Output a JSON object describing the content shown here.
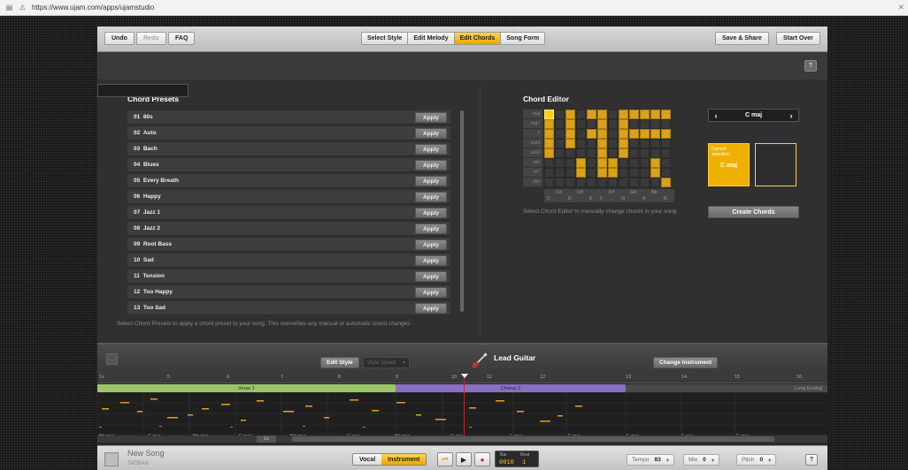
{
  "browser": {
    "url": "https://www.ujam.com/apps/ujamstudio"
  },
  "toolbar": {
    "undo": "Undo",
    "redo": "Redo",
    "faq": "FAQ",
    "tabs": [
      {
        "label": "Select Style",
        "active": false
      },
      {
        "label": "Edit Melody",
        "active": false
      },
      {
        "label": "Edit Chords",
        "active": true
      },
      {
        "label": "Song Form",
        "active": false
      }
    ],
    "save_share": "Save & Share",
    "start_over": "Start Over"
  },
  "help_label": "?",
  "chord_presets": {
    "title": "Chord Presets",
    "apply_label": "Apply",
    "items": [
      {
        "num": "01",
        "name": "80s"
      },
      {
        "num": "02",
        "name": "Auto"
      },
      {
        "num": "03",
        "name": "Bach"
      },
      {
        "num": "04",
        "name": "Blues"
      },
      {
        "num": "05",
        "name": "Every Breath"
      },
      {
        "num": "06",
        "name": "Happy"
      },
      {
        "num": "07",
        "name": "Jazz 1"
      },
      {
        "num": "08",
        "name": "Jazz 2"
      },
      {
        "num": "09",
        "name": "Root Bass"
      },
      {
        "num": "10",
        "name": "Sad"
      },
      {
        "num": "11",
        "name": "Tension"
      },
      {
        "num": "12",
        "name": "Too Happy"
      },
      {
        "num": "13",
        "name": "Too Sad"
      }
    ],
    "hint": "Select Chord Presets to apply a chord preset to your song. This overwrites any manual or automatic chord changes"
  },
  "chord_editor": {
    "title": "Chord Editor",
    "row_labels": [
      "maj",
      "maj7",
      "7",
      "sus4",
      "sus2",
      "min",
      "m7",
      "dim"
    ],
    "sharp_notes": [
      "C#",
      "D#",
      "F#",
      "G#",
      "Bb"
    ],
    "natural_notes": [
      "C",
      "D",
      "E",
      "F",
      "G",
      "A",
      "B"
    ],
    "grid": [
      [
        2,
        0,
        1,
        0,
        1,
        1,
        0,
        1,
        1,
        1,
        1,
        1
      ],
      [
        1,
        0,
        1,
        0,
        0,
        1,
        0,
        1,
        0,
        0,
        0,
        0
      ],
      [
        1,
        0,
        1,
        0,
        1,
        1,
        0,
        1,
        1,
        1,
        1,
        1
      ],
      [
        1,
        0,
        1,
        0,
        0,
        1,
        0,
        1,
        0,
        0,
        0,
        0
      ],
      [
        1,
        0,
        0,
        0,
        0,
        1,
        0,
        1,
        0,
        0,
        0,
        0
      ],
      [
        0,
        0,
        0,
        1,
        0,
        1,
        1,
        0,
        0,
        0,
        1,
        0
      ],
      [
        0,
        0,
        0,
        1,
        0,
        1,
        1,
        0,
        0,
        0,
        1,
        0
      ],
      [
        0,
        0,
        0,
        0,
        0,
        0,
        0,
        0,
        0,
        0,
        0,
        1
      ]
    ],
    "current_chord": "C maj",
    "current_selection_label": "Current selection:",
    "current_selection_value": "C maj",
    "create_button": "Create Chords",
    "hint": "Select Chord Editor to manually change chords in your song"
  },
  "instrument_bar": {
    "edit_style": "Edit Style",
    "style_speed": "Style Speed",
    "instrument_name": "Lead Guitar",
    "change_instrument": "Change Instrument"
  },
  "timeline": {
    "bars": [
      "1x",
      "5",
      "6",
      "7",
      "8",
      "9",
      "10",
      "11",
      "12",
      "13",
      "14",
      "15",
      "16"
    ],
    "sections": [
      {
        "label": "Verse 1",
        "color": "#9cc56a"
      },
      {
        "label": "Chorus 2",
        "color": "#8a70c0"
      },
      {
        "label": "Long Ending",
        "color": "#666666"
      }
    ],
    "chords": [
      "Bb maj",
      "C maj",
      "Bb maj",
      "F maj",
      "Bb maj",
      "C maj",
      "Bb maj",
      "D min",
      "F maj",
      "F maj",
      "F maj",
      "F maj",
      "F maj"
    ],
    "zoom": "1x"
  },
  "transport": {
    "song_title": "New Song",
    "song_sub": "TADBAN",
    "vocal": "Vocal",
    "instrument": "Instrument",
    "bar_label": "Bar",
    "beat_label": "Beat",
    "bar_value": "0010",
    "beat_value": "1",
    "tempo_label": "Tempo",
    "tempo_value": "83",
    "mix_label": "Mix",
    "mix_value": "0",
    "pitch_label": "Pitch",
    "pitch_value": "0"
  },
  "colors": {
    "accent": "#f0b000",
    "active_cell": "#d9a21a",
    "playhead": "#d02020"
  }
}
